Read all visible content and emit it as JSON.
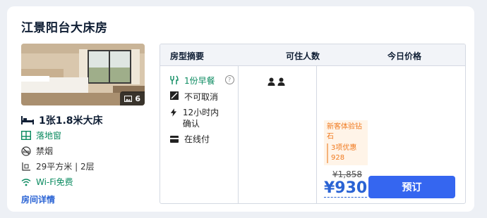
{
  "room": {
    "title": "江景阳台大床房",
    "photo_count": "6",
    "bed": "1张1.8米大床",
    "features": [
      "落地窗",
      "禁烟",
      "29平方米 | 2层",
      "Wi-Fi免费"
    ],
    "detail_link": "房间详情"
  },
  "table": {
    "headers": [
      "房型摘要",
      "可住人数",
      "今日价格"
    ],
    "policies": [
      "1份早餐",
      "不可取消",
      "12小时内确认",
      "在线付"
    ],
    "guest_icons": [
      "person-icon",
      "person-icon"
    ],
    "promo_title": "新客体验钻石",
    "promo_sub": "3项优惠928",
    "original_price": "¥1,858",
    "price": "¥930",
    "book_label": "预订"
  },
  "colors": {
    "accent": "#3566f0",
    "price": "#2a63d4",
    "green": "#0a8a5f",
    "promo": "#f07a1f"
  }
}
